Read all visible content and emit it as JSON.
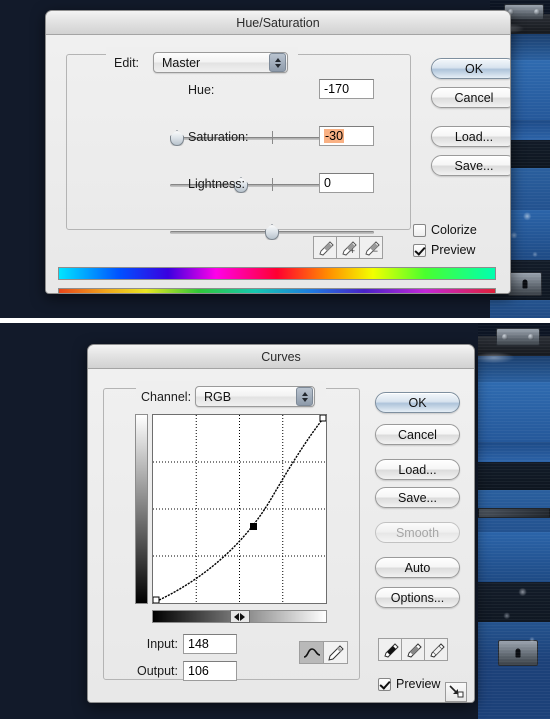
{
  "background": {
    "color": "#121a2a",
    "photo_description": "blue-tinted vintage trunk"
  },
  "divider": {
    "color": "#ffffff"
  },
  "hue_saturation_dialog": {
    "title": "Hue/Saturation",
    "edit_label": "Edit:",
    "edit_value": "Master",
    "sliders": [
      {
        "label": "Hue:",
        "value": "-170",
        "min": -180,
        "max": 180,
        "selected": false
      },
      {
        "label": "Saturation:",
        "value": "-30",
        "min": -100,
        "max": 100,
        "selected": true
      },
      {
        "label": "Lightness:",
        "value": "0",
        "min": -100,
        "max": 100,
        "selected": false
      }
    ],
    "buttons": [
      {
        "label": "OK",
        "default": true,
        "disabled": false
      },
      {
        "label": "Cancel",
        "default": false,
        "disabled": false
      },
      {
        "label": "Load...",
        "default": false,
        "disabled": false
      },
      {
        "label": "Save...",
        "default": false,
        "disabled": false
      }
    ],
    "checkboxes": [
      {
        "label": "Colorize",
        "checked": false
      },
      {
        "label": "Preview",
        "checked": true
      }
    ],
    "eyedroppers": [
      {
        "name": "eyedropper-icon",
        "sign": ""
      },
      {
        "name": "eyedropper-plus-icon",
        "sign": "+"
      },
      {
        "name": "eyedropper-minus-icon",
        "sign": "−"
      }
    ],
    "selection_highlight_color": "#f9b184"
  },
  "curves_dialog": {
    "title": "Curves",
    "channel_label": "Channel:",
    "channel_value": "RGB",
    "input_label": "Input:",
    "input_value": "148",
    "output_label": "Output:",
    "output_value": "106",
    "buttons": [
      {
        "label": "OK",
        "default": true,
        "disabled": false
      },
      {
        "label": "Cancel",
        "default": false,
        "disabled": false
      },
      {
        "label": "Load...",
        "default": false,
        "disabled": false
      },
      {
        "label": "Save...",
        "default": false,
        "disabled": false
      },
      {
        "label": "Smooth",
        "default": false,
        "disabled": true
      },
      {
        "label": "Auto",
        "default": false,
        "disabled": false
      },
      {
        "label": "Options...",
        "default": false,
        "disabled": false
      }
    ],
    "checkboxes": [
      {
        "label": "Preview",
        "checked": true
      }
    ],
    "eyedroppers": [
      {
        "name": "eyedropper-black-point-icon"
      },
      {
        "name": "eyedropper-gray-point-icon"
      },
      {
        "name": "eyedropper-white-point-icon"
      }
    ],
    "tools": [
      {
        "name": "curve-tool",
        "selected": true
      },
      {
        "name": "pencil-tool",
        "selected": false
      }
    ],
    "grid_divisions": 4
  },
  "chart_data": {
    "type": "line",
    "title": "Curves",
    "xlabel": "Input",
    "ylabel": "Output",
    "xlim": [
      0,
      255
    ],
    "ylim": [
      0,
      255
    ],
    "grid": true,
    "grid_divisions": 4,
    "legend": "none",
    "series": [
      {
        "name": "RGB",
        "x": [
          0,
          32,
          64,
          96,
          128,
          148,
          160,
          192,
          224,
          255
        ],
        "y": [
          0,
          17,
          38,
          62,
          88,
          106,
          116,
          152,
          198,
          255
        ]
      }
    ],
    "control_points": [
      {
        "x": 0,
        "y": 0,
        "type": "endpoint"
      },
      {
        "x": 148,
        "y": 106,
        "type": "selected"
      },
      {
        "x": 255,
        "y": 255,
        "type": "endpoint"
      }
    ],
    "annotations": [
      {
        "label": "Input",
        "value": "148"
      },
      {
        "label": "Output",
        "value": "106"
      }
    ]
  }
}
